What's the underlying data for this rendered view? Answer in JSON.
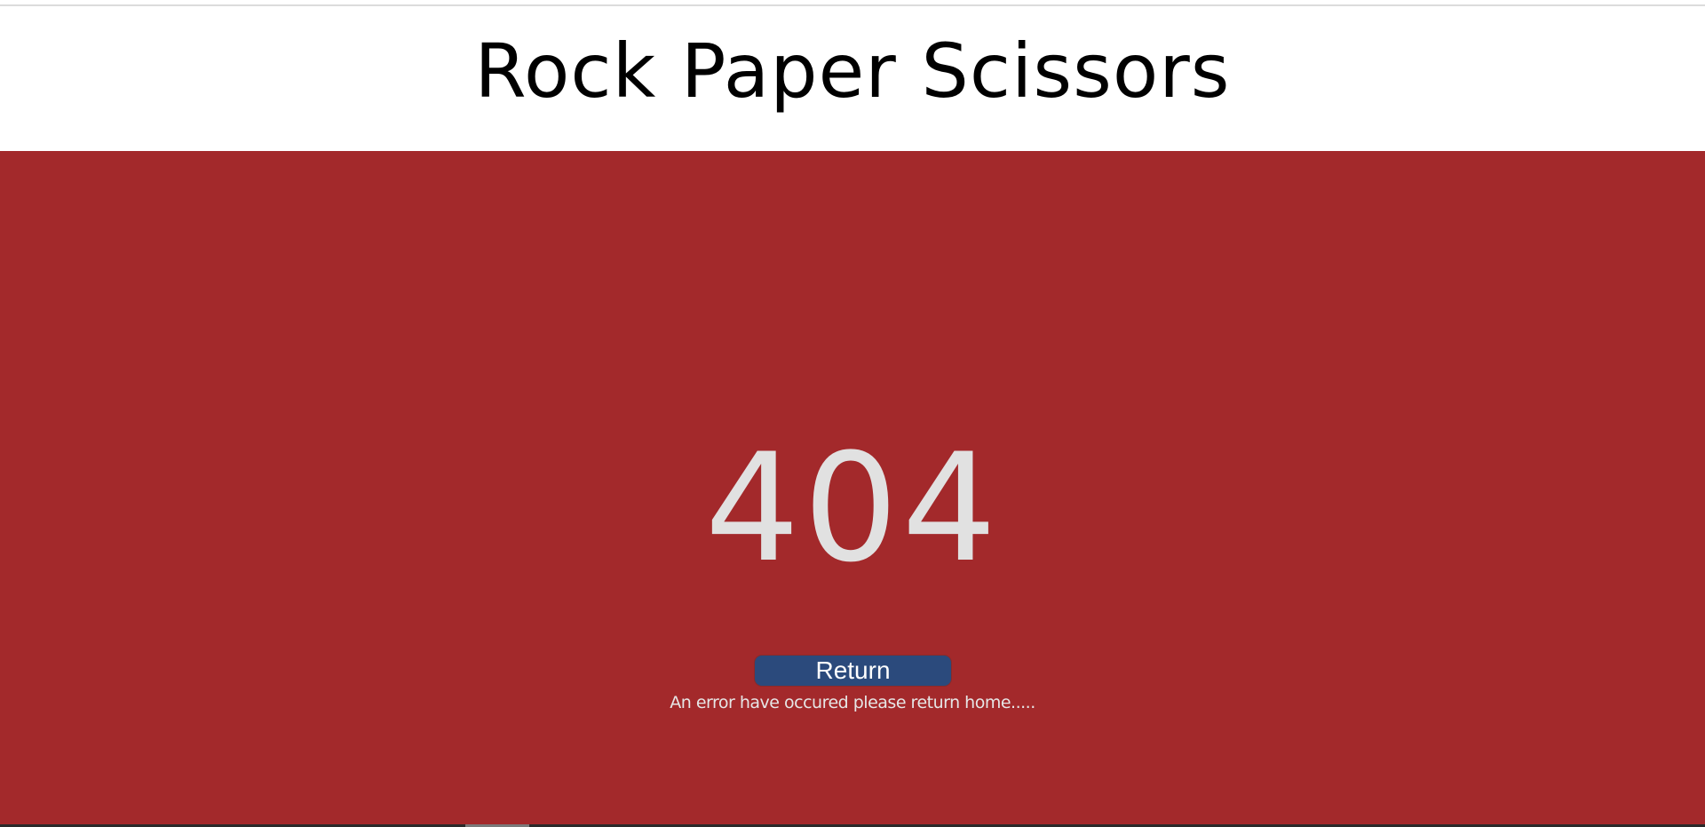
{
  "header": {
    "title": "Rock Paper Scissors"
  },
  "main": {
    "error_code": "404",
    "return_label": "Return",
    "message": "An error have occured please return home....."
  },
  "colors": {
    "header_bg": "#ffffff",
    "main_bg": "#a3292b",
    "button_bg": "#2b4a7c",
    "error_text": "#e1e1e1"
  }
}
